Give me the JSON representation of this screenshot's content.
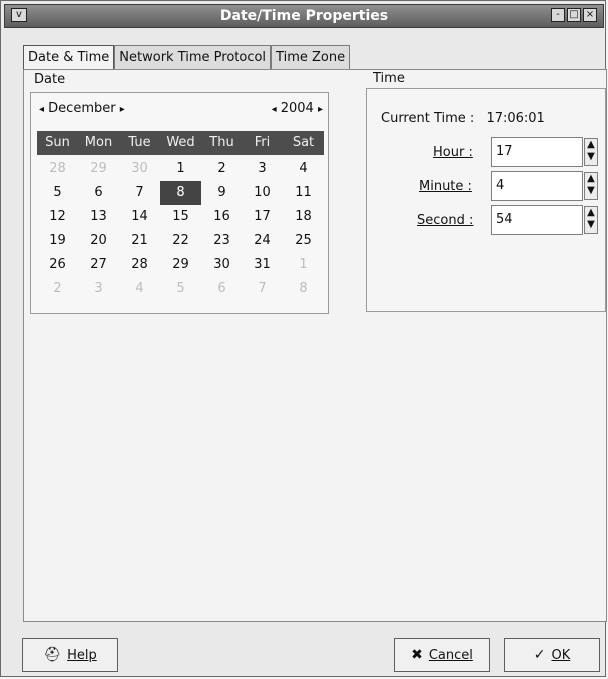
{
  "window": {
    "title": "Date/Time Properties",
    "menu_glyph": "v",
    "controls": [
      "-",
      "□",
      "×"
    ]
  },
  "tabs": [
    {
      "label": "Date & Time",
      "active": true
    },
    {
      "label": "Network Time Protocol",
      "active": false
    },
    {
      "label": "Time Zone",
      "active": false
    }
  ],
  "date": {
    "label": "Date",
    "month": "December",
    "year": "2004",
    "weekdays": [
      "Sun",
      "Mon",
      "Tue",
      "Wed",
      "Thu",
      "Fri",
      "Sat"
    ],
    "weeks": [
      [
        "28",
        "29",
        "30",
        "1",
        "2",
        "3",
        "4"
      ],
      [
        "5",
        "6",
        "7",
        "8",
        "9",
        "10",
        "11"
      ],
      [
        "12",
        "13",
        "14",
        "15",
        "16",
        "17",
        "18"
      ],
      [
        "19",
        "20",
        "21",
        "22",
        "23",
        "24",
        "25"
      ],
      [
        "26",
        "27",
        "28",
        "29",
        "30",
        "31",
        "1"
      ],
      [
        "2",
        "3",
        "4",
        "5",
        "6",
        "7",
        "8"
      ]
    ],
    "selected": "8",
    "muted_cells": [
      [
        0,
        0
      ],
      [
        0,
        1
      ],
      [
        0,
        2
      ],
      [
        4,
        6
      ],
      [
        5,
        0
      ],
      [
        5,
        1
      ],
      [
        5,
        2
      ],
      [
        5,
        3
      ],
      [
        5,
        4
      ],
      [
        5,
        5
      ],
      [
        5,
        6
      ]
    ]
  },
  "time": {
    "label": "Time",
    "current_label": "Current Time :",
    "current_value": "17:06:01",
    "hour_label": "Hour :",
    "hour_value": "17",
    "minute_label": "Minute :",
    "minute_value": "4",
    "second_label": "Second :",
    "second_value": "54"
  },
  "buttons": {
    "help": "Help",
    "cancel": "Cancel",
    "ok": "OK"
  },
  "icons": {
    "menu": "chevron-down-icon",
    "minimize": "minimize-icon",
    "maximize": "maximize-icon",
    "close": "close-icon",
    "help": "help-icon",
    "cancel": "cancel-icon",
    "ok": "ok-icon"
  }
}
